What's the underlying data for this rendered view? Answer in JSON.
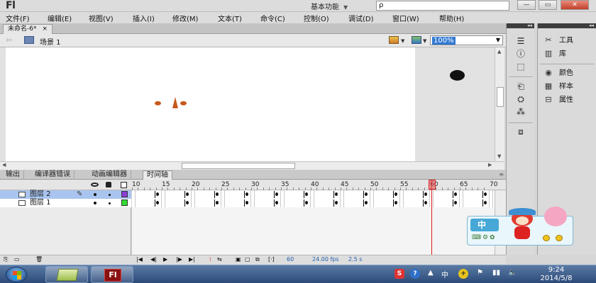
{
  "app": {
    "logo": "Fl",
    "workspace": "基本功能",
    "search_placeholder": "ρ"
  },
  "window_controls": {
    "minimize": "—",
    "restore": "▭",
    "close": "✕"
  },
  "menu": [
    "文件(F)",
    "编辑(E)",
    "视图(V)",
    "插入(I)",
    "修改(M)",
    "文本(T)",
    "命令(C)",
    "控制(O)",
    "调试(D)",
    "窗口(W)",
    "帮助(H)"
  ],
  "document": {
    "tab": "未命名-6*",
    "tab_close": "×",
    "scene": "场景 1",
    "zoom": "100%"
  },
  "panel_tabs": [
    "输出",
    "编译器错误",
    "动画编辑器",
    "时间轴"
  ],
  "timeline": {
    "ruler": [
      "10",
      "15",
      "20",
      "25",
      "30",
      "35",
      "40",
      "45",
      "50",
      "55",
      "60",
      "65",
      "70"
    ],
    "playhead": "60",
    "layers": [
      {
        "name": "图层 2",
        "selected": true,
        "color": "#8b3fd8"
      },
      {
        "name": "图层 1",
        "selected": false,
        "color": "#33dd33"
      }
    ],
    "footer": {
      "frame": "60",
      "fps": "24.00 fps",
      "time": "2.5 s"
    }
  },
  "right_panel": {
    "items": [
      "工具",
      "库",
      "颜色",
      "样本",
      "属性"
    ],
    "icons": [
      "tools-icon",
      "library-icon",
      "color-icon",
      "swatches-icon",
      "properties-icon"
    ]
  },
  "ime": {
    "label": "中"
  },
  "taskbar": {
    "time": "9:24",
    "date": "2014/5/8",
    "app_fl": "Fl"
  },
  "colors": {
    "accent": "#3179d3",
    "playhead": "#e21b1b",
    "stage": "#ffffff",
    "paste": "#c65a1c"
  }
}
